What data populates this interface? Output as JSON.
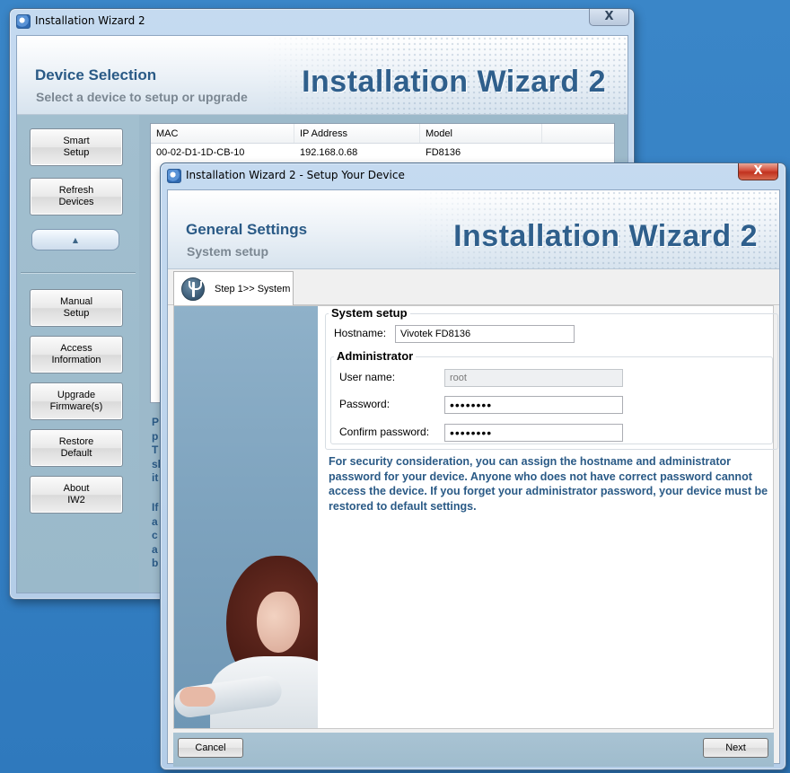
{
  "back_window": {
    "title": "Installation Wizard 2",
    "close": "X",
    "banner": {
      "title": "Device Selection",
      "subtitle": "Select a device to setup or upgrade",
      "brand": "Installation Wizard 2"
    },
    "sidebar": {
      "buttons": [
        "Smart\nSetup",
        "Refresh\nDevices",
        "Manual\nSetup",
        "Access\nInformation",
        "Upgrade\nFirmware(s)",
        "Restore\nDefault",
        "About\nIW2"
      ],
      "collapse_glyph": "▲"
    },
    "device_list": {
      "columns": [
        "MAC",
        "IP Address",
        "Model",
        ""
      ],
      "rows": [
        [
          "00-02-D1-1D-CB-10",
          "192.168.0.68",
          "FD8136",
          ""
        ]
      ]
    },
    "obscured_text": {
      "block1": "P\np\nT\nsl\nit",
      "block2": "If\na\nc\na\nb"
    }
  },
  "dialog": {
    "title": "Installation Wizard 2 - Setup Your Device",
    "close": "X",
    "banner": {
      "title": "General Settings",
      "subtitle": "System setup",
      "brand": "Installation Wizard 2"
    },
    "step_tab": "Step 1>> System",
    "system_setup": {
      "title": "System setup",
      "hostname_label": "Hostname:",
      "hostname_value": "Vivotek FD8136"
    },
    "administrator": {
      "title": "Administrator",
      "username_label": "User name:",
      "username_value": "root",
      "password_label": "Password:",
      "password_value": "••••••••",
      "confirm_label": "Confirm password:",
      "confirm_value": "••••••••"
    },
    "hint": "For security consideration, you can assign the hostname and administrator password for your device. Anyone who does not have correct password cannot access the device. If you forget your administrator password, your device must be restored to default settings.",
    "buttons": {
      "cancel": "Cancel",
      "next": "Next"
    }
  }
}
